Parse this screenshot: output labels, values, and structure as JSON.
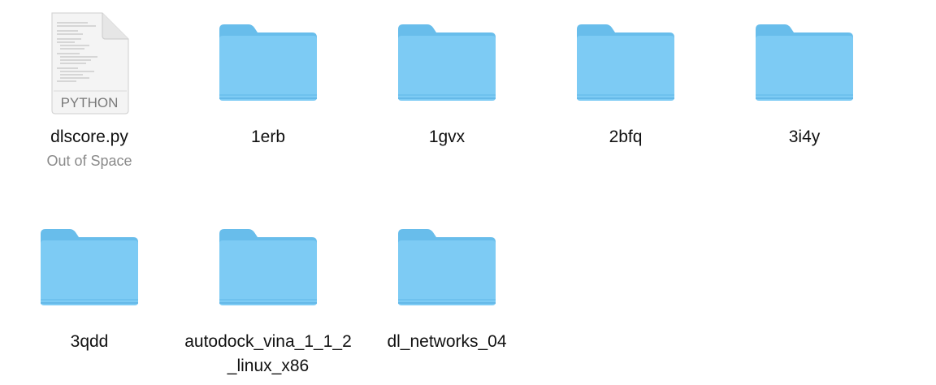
{
  "files": [
    {
      "name": "dlscore.py",
      "kind": "python-file",
      "type_label": "PYTHON",
      "subtitle": "Out of Space"
    },
    {
      "name": "1erb",
      "kind": "folder"
    },
    {
      "name": "1gvx",
      "kind": "folder"
    },
    {
      "name": "2bfq",
      "kind": "folder"
    },
    {
      "name": "3i4y",
      "kind": "folder"
    },
    {
      "name": "3qdd",
      "kind": "folder"
    },
    {
      "name": "autodock_vina_1_1_2_linux_x86",
      "kind": "folder"
    },
    {
      "name": "dl_networks_04",
      "kind": "folder"
    }
  ],
  "colors": {
    "folder_front": "#7DCBF4",
    "folder_back": "#68BDEB",
    "folder_edge": "#5FB2E2",
    "doc_page": "#F4F4F4",
    "doc_border": "#D6D6D6",
    "text": "#111111",
    "subtext": "#8a8a8a"
  }
}
